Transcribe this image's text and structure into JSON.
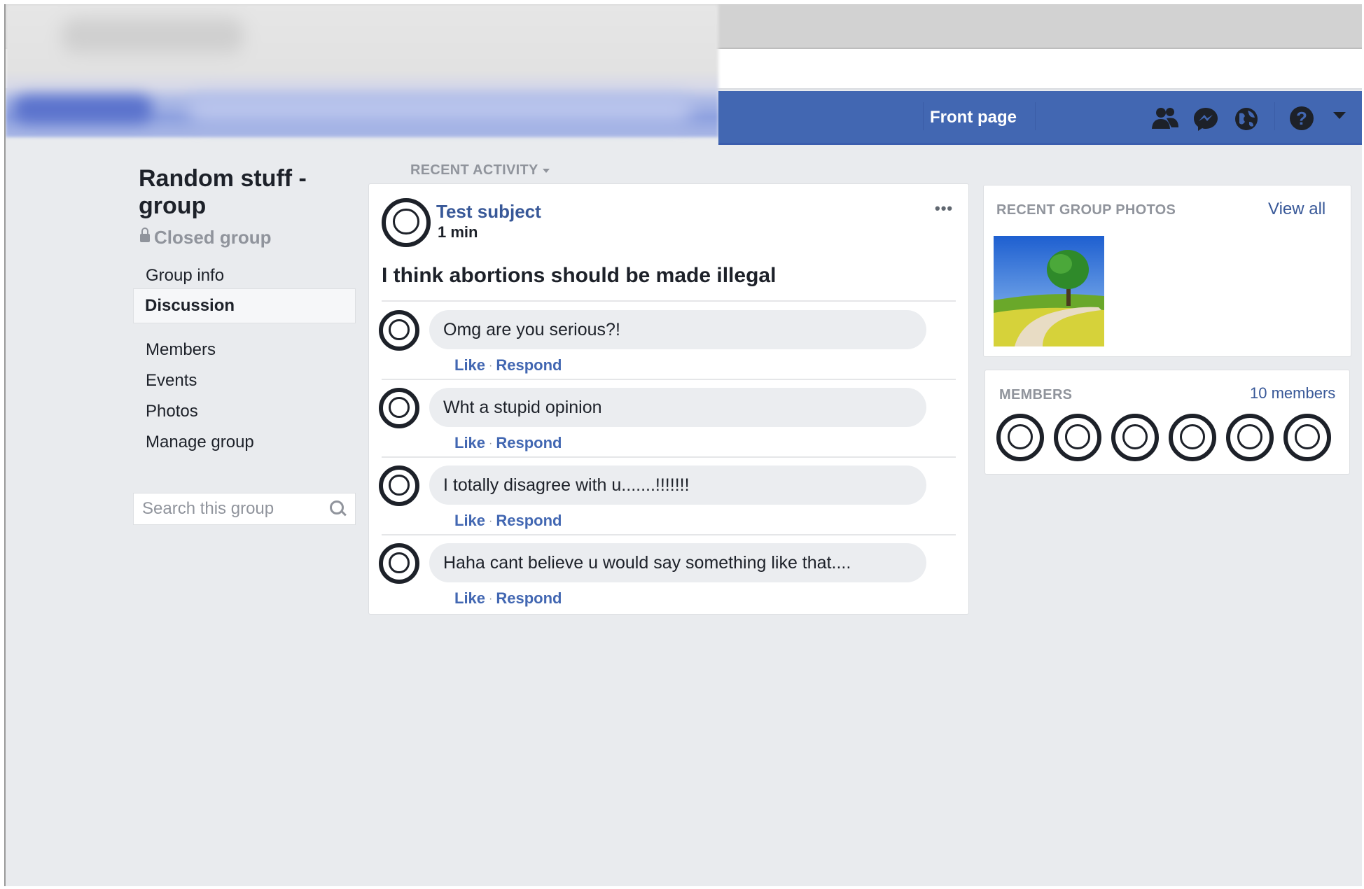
{
  "topbar": {
    "front_page": "Front page"
  },
  "group": {
    "title": "Random stuff -group",
    "privacy": "Closed group"
  },
  "nav": {
    "group_info": "Group info",
    "discussion": "Discussion",
    "members": "Members",
    "events": "Events",
    "photos": "Photos",
    "manage": "Manage group"
  },
  "search": {
    "placeholder": "Search this group"
  },
  "feed": {
    "section_label": "RECENT ACTIVITY",
    "post": {
      "author": "Test subject",
      "time": "1 min",
      "text": "I think abortions should be made illegal",
      "more": "•••"
    },
    "comments": [
      {
        "text": "Omg are you serious?!",
        "like": "Like",
        "respond": "Respond"
      },
      {
        "text": "Wht a stupid opinion",
        "like": "Like",
        "respond": "Respond"
      },
      {
        "text": "I totally disagree with u.......!!!!!!!",
        "like": "Like",
        "respond": "Respond"
      },
      {
        "text": "Haha cant believe u would say something like that....",
        "like": "Like",
        "respond": "Respond"
      }
    ]
  },
  "photos_card": {
    "heading": "RECENT GROUP PHOTOS",
    "view_all": "View all"
  },
  "members_card": {
    "heading": "MEMBERS",
    "count": "10 members"
  },
  "colors": {
    "brand_blue": "#4267b2",
    "link_blue": "#385898",
    "background": "#e9ebee"
  }
}
